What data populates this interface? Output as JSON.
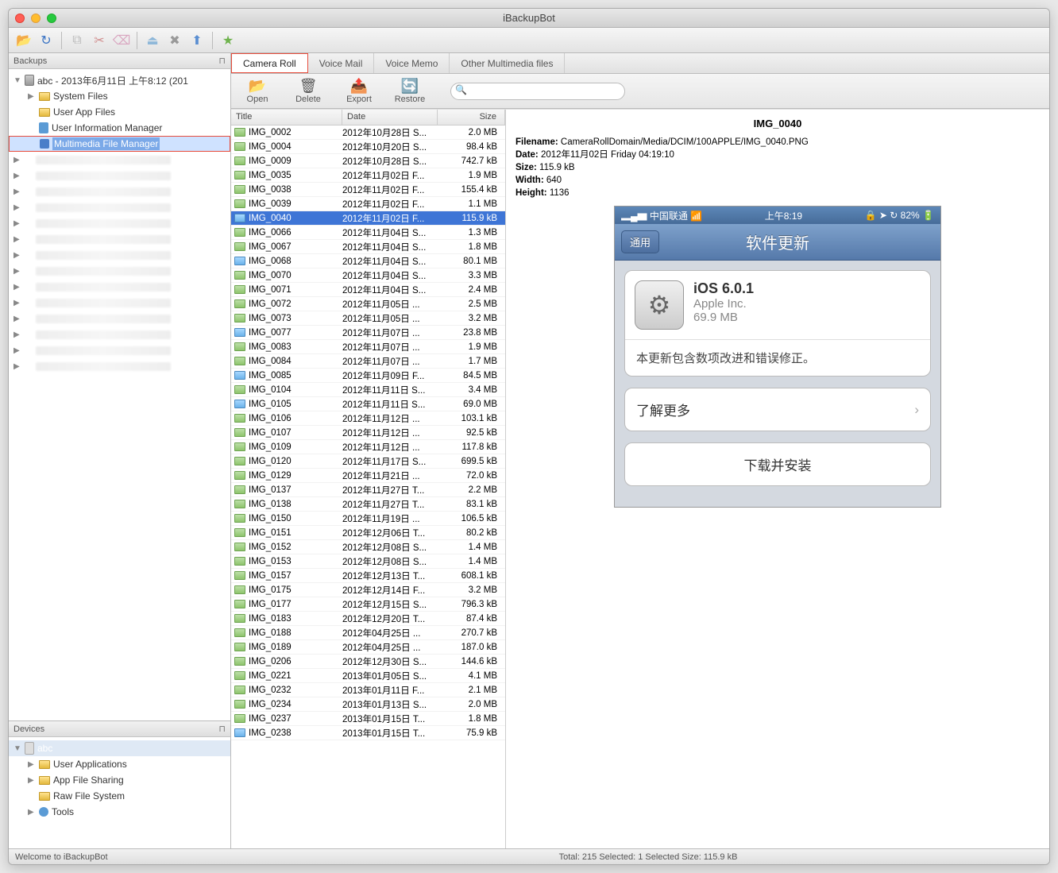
{
  "window": {
    "title": "iBackupBot"
  },
  "sidebar": {
    "backups_label": "Backups",
    "devices_label": "Devices",
    "root": "abc - 2013年6月11日 上午8:12 (201",
    "items": [
      {
        "label": "System Files"
      },
      {
        "label": "User App Files"
      },
      {
        "label": "User Information Manager"
      },
      {
        "label": "Multimedia File Manager"
      }
    ],
    "device_root": "abc",
    "dev_items": [
      {
        "label": "User Applications"
      },
      {
        "label": "App File Sharing"
      },
      {
        "label": "Raw File System"
      },
      {
        "label": "Tools"
      }
    ]
  },
  "tabs": [
    {
      "label": "Camera Roll"
    },
    {
      "label": "Voice Mail"
    },
    {
      "label": "Voice Memo"
    },
    {
      "label": "Other Multimedia files"
    }
  ],
  "actions": {
    "open": "Open",
    "delete": "Delete",
    "export": "Export",
    "restore": "Restore"
  },
  "search": {
    "placeholder": ""
  },
  "columns": {
    "title": "Title",
    "date": "Date",
    "size": "Size"
  },
  "files": [
    {
      "title": "IMG_0002",
      "date": "2012年10月28日 S...",
      "size": "2.0 MB"
    },
    {
      "title": "IMG_0004",
      "date": "2012年10月20日 S...",
      "size": "98.4 kB"
    },
    {
      "title": "IMG_0009",
      "date": "2012年10月28日 S...",
      "size": "742.7 kB"
    },
    {
      "title": "IMG_0035",
      "date": "2012年11月02日 F...",
      "size": "1.9 MB"
    },
    {
      "title": "IMG_0038",
      "date": "2012年11月02日 F...",
      "size": "155.4 kB"
    },
    {
      "title": "IMG_0039",
      "date": "2012年11月02日 F...",
      "size": "1.1 MB"
    },
    {
      "title": "IMG_0040",
      "date": "2012年11月02日 F...",
      "size": "115.9 kB",
      "sel": true,
      "blue": true
    },
    {
      "title": "IMG_0066",
      "date": "2012年11月04日 S...",
      "size": "1.3 MB"
    },
    {
      "title": "IMG_0067",
      "date": "2012年11月04日 S...",
      "size": "1.8 MB"
    },
    {
      "title": "IMG_0068",
      "date": "2012年11月04日 S...",
      "size": "80.1 MB",
      "blue": true
    },
    {
      "title": "IMG_0070",
      "date": "2012年11月04日 S...",
      "size": "3.3 MB"
    },
    {
      "title": "IMG_0071",
      "date": "2012年11月04日 S...",
      "size": "2.4 MB"
    },
    {
      "title": "IMG_0072",
      "date": "2012年11月05日 ...",
      "size": "2.5 MB"
    },
    {
      "title": "IMG_0073",
      "date": "2012年11月05日 ...",
      "size": "3.2 MB"
    },
    {
      "title": "IMG_0077",
      "date": "2012年11月07日 ...",
      "size": "23.8 MB",
      "blue": true
    },
    {
      "title": "IMG_0083",
      "date": "2012年11月07日 ...",
      "size": "1.9 MB"
    },
    {
      "title": "IMG_0084",
      "date": "2012年11月07日 ...",
      "size": "1.7 MB"
    },
    {
      "title": "IMG_0085",
      "date": "2012年11月09日 F...",
      "size": "84.5 MB",
      "blue": true
    },
    {
      "title": "IMG_0104",
      "date": "2012年11月11日 S...",
      "size": "3.4 MB"
    },
    {
      "title": "IMG_0105",
      "date": "2012年11月11日 S...",
      "size": "69.0 MB",
      "blue": true
    },
    {
      "title": "IMG_0106",
      "date": "2012年11月12日 ...",
      "size": "103.1 kB"
    },
    {
      "title": "IMG_0107",
      "date": "2012年11月12日 ...",
      "size": "92.5 kB"
    },
    {
      "title": "IMG_0109",
      "date": "2012年11月12日 ...",
      "size": "117.8 kB"
    },
    {
      "title": "IMG_0120",
      "date": "2012年11月17日 S...",
      "size": "699.5 kB"
    },
    {
      "title": "IMG_0129",
      "date": "2012年11月21日 ...",
      "size": "72.0 kB"
    },
    {
      "title": "IMG_0137",
      "date": "2012年11月27日 T...",
      "size": "2.2 MB"
    },
    {
      "title": "IMG_0138",
      "date": "2012年11月27日 T...",
      "size": "83.1 kB"
    },
    {
      "title": "IMG_0150",
      "date": "2012年11月19日 ...",
      "size": "106.5 kB"
    },
    {
      "title": "IMG_0151",
      "date": "2012年12月06日 T...",
      "size": "80.2 kB"
    },
    {
      "title": "IMG_0152",
      "date": "2012年12月08日 S...",
      "size": "1.4 MB"
    },
    {
      "title": "IMG_0153",
      "date": "2012年12月08日 S...",
      "size": "1.4 MB"
    },
    {
      "title": "IMG_0157",
      "date": "2012年12月13日 T...",
      "size": "608.1 kB"
    },
    {
      "title": "IMG_0175",
      "date": "2012年12月14日 F...",
      "size": "3.2 MB"
    },
    {
      "title": "IMG_0177",
      "date": "2012年12月15日 S...",
      "size": "796.3 kB"
    },
    {
      "title": "IMG_0183",
      "date": "2012年12月20日 T...",
      "size": "87.4 kB"
    },
    {
      "title": "IMG_0188",
      "date": "2012年04月25日 ...",
      "size": "270.7 kB"
    },
    {
      "title": "IMG_0189",
      "date": "2012年04月25日 ...",
      "size": "187.0 kB"
    },
    {
      "title": "IMG_0206",
      "date": "2012年12月30日 S...",
      "size": "144.6 kB"
    },
    {
      "title": "IMG_0221",
      "date": "2013年01月05日 S...",
      "size": "4.1 MB"
    },
    {
      "title": "IMG_0232",
      "date": "2013年01月11日 F...",
      "size": "2.1 MB"
    },
    {
      "title": "IMG_0234",
      "date": "2013年01月13日 S...",
      "size": "2.0 MB"
    },
    {
      "title": "IMG_0237",
      "date": "2013年01月15日 T...",
      "size": "1.8 MB"
    },
    {
      "title": "IMG_0238",
      "date": "2013年01月15日 T...",
      "size": "75.9 kB",
      "blue": true
    }
  ],
  "detail": {
    "heading": "IMG_0040",
    "labels": {
      "filename": "Filename:",
      "date": "Date:",
      "size": "Size:",
      "width": "Width:",
      "height": "Height:"
    },
    "filename": "CameraRollDomain/Media/DCIM/100APPLE/IMG_0040.PNG",
    "date": "2012年11月02日 Friday 04:19:10",
    "size": "115.9 kB",
    "width": "640",
    "height": "1136"
  },
  "phone": {
    "carrier": "中国联通",
    "time": "上午8:19",
    "battery": "82%",
    "back": "通用",
    "title": "软件更新",
    "update_title": "iOS 6.0.1",
    "update_vendor": "Apple Inc.",
    "update_size": "69.9 MB",
    "update_desc": "本更新包含数项改进和错误修正。",
    "learn_more": "了解更多",
    "download": "下载并安装"
  },
  "status": {
    "left": "Welcome to iBackupBot",
    "center": "Total: 215 Selected: 1 Selected Size: 115.9 kB"
  }
}
